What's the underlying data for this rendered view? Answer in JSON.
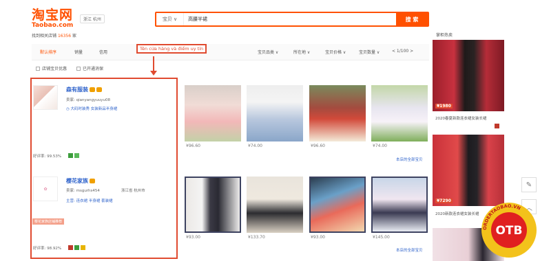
{
  "header": {
    "logo_cn": "淘宝网",
    "logo_en": "Taobao.com",
    "region": "浙江 杭州",
    "search_type": "宝贝 ∨",
    "search_value": "高腰半裙",
    "search_button": "搜 索",
    "notice_prefix": "找到相关店铺",
    "notice_count": "16356",
    "notice_suffix": "家"
  },
  "tabs": [
    "默认排序",
    "销量",
    "信用"
  ],
  "filters": [
    "宝贝品类 ∨",
    "所在地 ∨",
    "宝贝价格 ∨",
    "宝贝数量 ∨"
  ],
  "pager": "< 1/100 >",
  "checkboxes": [
    "店铺宝贝优惠",
    "已开通消保"
  ],
  "annotation": "Tên cửa hàng và điểm uy tín",
  "shops": [
    {
      "name": "森有服装",
      "seller": "卖家: qianyangyuuyu08",
      "links": "◷ 大码时装秀 女装新品半身裙",
      "rating": "好评率: 99.53%"
    },
    {
      "name": "樱花家族",
      "seller": "卖家: msgurhs454",
      "location": "浙江省 杭州市",
      "links": "主营: 连衣裙 半身裙 套装裙",
      "tag": "樱花家族店铺推荐",
      "rating": "好评率: 98.92%"
    }
  ],
  "products": {
    "row1_prices": [
      "¥96.60",
      "¥74.00",
      "¥96.60",
      "¥74.00"
    ],
    "row2_prices": [
      "¥93.00",
      "¥133.70",
      "¥93.00",
      "¥145.00"
    ],
    "more_label": "本店的全部宝贝"
  },
  "right": {
    "title": "掌柜热卖",
    "ads": [
      {
        "price": "¥1980",
        "caption": "2020春夏新款连衣裙女装长裙"
      },
      {
        "price": "¥7290",
        "caption": "2020新款连衣裙女装长裙"
      }
    ]
  },
  "watermark": {
    "text": "OTB",
    "ring": "ORDERTAOBAO.VN"
  },
  "colors": {
    "accent": "#ff5000",
    "annotation": "#e04a2f",
    "link": "#3366cc"
  },
  "icons": [
    "pencil-icon",
    "chevron-up-icon",
    "crown-icon"
  ]
}
